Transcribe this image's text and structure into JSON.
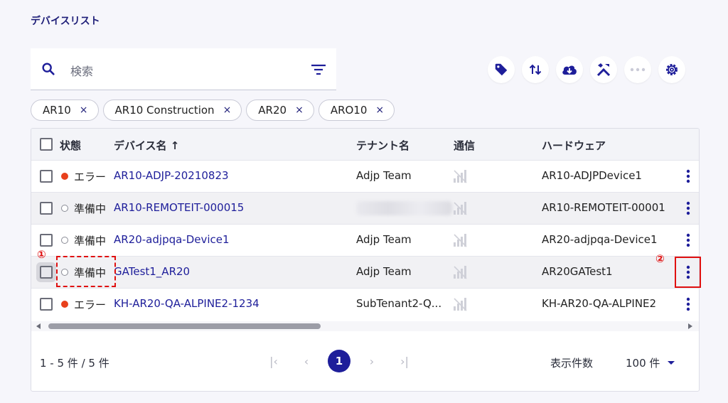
{
  "page_title": "デバイスリスト",
  "search": {
    "placeholder": "検索"
  },
  "toolbar": {
    "icons": [
      "tag-icon",
      "sort-icon",
      "cloud-download-icon",
      "tools-icon",
      "more-horizontal-icon",
      "settings-icon"
    ]
  },
  "filter_chips": [
    {
      "label": "AR10",
      "remove": "×"
    },
    {
      "label": "AR10 Construction",
      "remove": "×"
    },
    {
      "label": "AR20",
      "remove": "×"
    },
    {
      "label": "ARO10",
      "remove": "×"
    }
  ],
  "table": {
    "columns": {
      "status": "状態",
      "device_name": "デバイス名 ↑",
      "tenant": "テナント名",
      "comm": "通信",
      "hardware": "ハードウェア"
    },
    "rows": [
      {
        "status": "エラー",
        "status_type": "error",
        "device_name": "AR10-ADJP-20210823",
        "tenant": "Adjp Team",
        "hardware": "AR10-ADJPDevice1"
      },
      {
        "status": "準備中",
        "status_type": "preparing",
        "device_name": "AR10-REMOTEIT-000015",
        "tenant": "",
        "hardware": "AR10-REMOTEIT-00001"
      },
      {
        "status": "準備中",
        "status_type": "preparing",
        "device_name": "AR20-adjpqa-Device1",
        "tenant": "Adjp Team",
        "hardware": "AR20-adjpqa-Device1"
      },
      {
        "status": "準備中",
        "status_type": "preparing",
        "device_name": "GATest1_AR20",
        "tenant": "Adjp Team",
        "hardware": "AR20GATest1"
      },
      {
        "status": "エラー",
        "status_type": "error",
        "device_name": "KH-AR20-QA-ALPINE2-1234",
        "tenant": "SubTenant2-Q...",
        "hardware": "KH-AR20-QA-ALPINE2"
      }
    ]
  },
  "pagination": {
    "range": "1 - 5 件 / 5 件",
    "current_page": "1",
    "per_page_label": "表示件数",
    "per_page_value": "100 件"
  },
  "annotations": {
    "marker1": "①",
    "marker2": "②"
  },
  "colors": {
    "accent": "#1e1e9a",
    "error": "#e8401c",
    "annotation": "#e01010"
  }
}
